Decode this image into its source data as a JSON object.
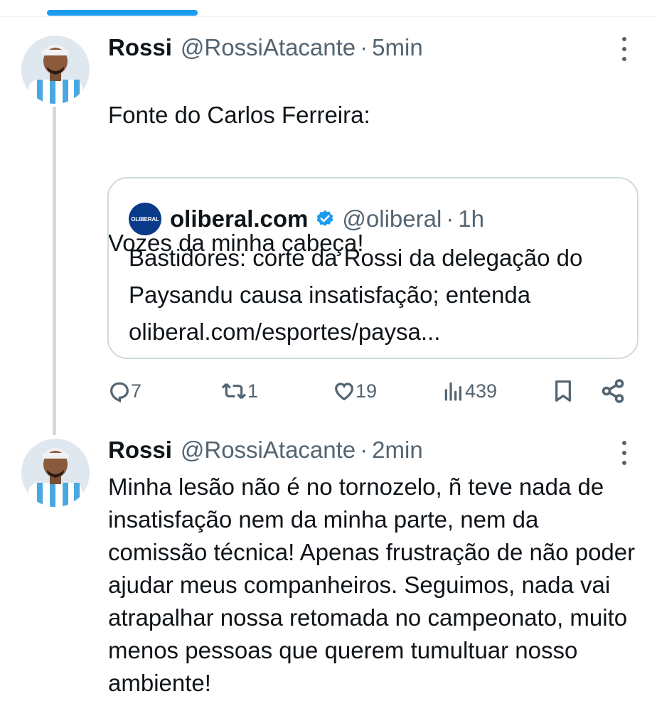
{
  "tweets": [
    {
      "name": "Rossi",
      "handle": "@RossiAtacante",
      "separator": "·",
      "time": "5min",
      "text_line1": "Fonte do Carlos Ferreira:",
      "text_line2": "Vozes da minha cabeça!",
      "quote": {
        "logo_text": "OLIBERAL",
        "name": "oliberal.com",
        "handle": "@oliberal",
        "separator": "·",
        "time": "1h",
        "text": "Bastidores: corte da Rossi da delegação do Paysandu causa insatisfação; entenda oliberal.com/esportes/paysa..."
      },
      "actions": {
        "replies": "7",
        "retweets": "1",
        "likes": "19",
        "views": "439"
      }
    },
    {
      "name": "Rossi",
      "handle": "@RossiAtacante",
      "separator": "·",
      "time": "2min",
      "text": "Minha lesão não é no tornozelo, ñ teve nada de insatisfação nem da minha parte, nem da comissão técnica! Apenas frustração de não poder ajudar meus companheiros. Seguimos, nada vai atrapalhar nossa retomada no campeonato, muito menos pessoas que querem tumultuar nosso ambiente!"
    }
  ],
  "icons": {
    "reply": "reply-icon",
    "retweet": "retweet-icon",
    "like": "heart-icon",
    "views": "views-icon",
    "bookmark": "bookmark-icon",
    "share": "share-icon",
    "more": "more-icon",
    "verified": "verified-badge-icon"
  },
  "colors": {
    "accent": "#1d9bf0",
    "text": "#0f1419",
    "secondary": "#536471",
    "border": "#cfd9de"
  }
}
